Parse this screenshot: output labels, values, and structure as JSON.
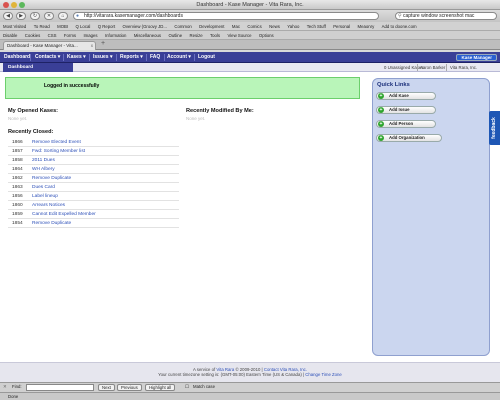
{
  "window": {
    "title": "Dashboard - Kase Manager - Vita Rara, Inc."
  },
  "toolbar": {
    "back": "◀",
    "forward": "▶",
    "reload": "↻",
    "stop": "✕",
    "home": "⌂",
    "url": "http://vitarara.kasemanager.com/dashboards",
    "search_value": "capture window screenshot mac"
  },
  "bookmarks": [
    "Most Visited",
    "To Read",
    "MOBI",
    "Q Local",
    "Q Report",
    "Overview (Groovy JD...",
    "Common",
    "Development",
    "Mac",
    "Comics",
    "News",
    "Yahoo",
    "Tech Stuff",
    "Personal",
    "Meaonry",
    "Add to doone.com"
  ],
  "devbar": [
    "Disable",
    "Cookies",
    "CSS",
    "Forms",
    "Images",
    "Information",
    "Miscellaneous",
    "Outline",
    "Resize",
    "Tools",
    "View Source",
    "Options"
  ],
  "tab": {
    "label": "Dashboard - Kase Manager - Vita...",
    "close": "x",
    "new": "+"
  },
  "appnav": {
    "items": [
      "Dashboard",
      "Contacts ▾",
      "Kases ▾",
      "Issues ▾",
      "Reports ▾",
      "FAQ",
      "Account ▾",
      "Logout"
    ],
    "brand": "Kase Manager"
  },
  "subnav": {
    "active": "Dashboard",
    "right": [
      "0 Unassigned Kases",
      "Aaron Barker",
      "Vita Rara, Inc."
    ]
  },
  "notice": "Logged in successfully",
  "opened": {
    "title": "My Opened Kases:",
    "empty": "None yet."
  },
  "modified": {
    "title": "Recently Modified By Me:",
    "empty": "None yet."
  },
  "closed": {
    "title": "Recently Closed:",
    "rows": [
      {
        "num": "1866",
        "title": "Remove Elected Event"
      },
      {
        "num": "1857",
        "title": "Fwd: Sorting Member list"
      },
      {
        "num": "1858",
        "title": "2011 Dues"
      },
      {
        "num": "1864",
        "title": "WH Albery"
      },
      {
        "num": "1862",
        "title": "Remove Duplicate"
      },
      {
        "num": "1863",
        "title": "Dues Card"
      },
      {
        "num": "1856",
        "title": "Label lineup"
      },
      {
        "num": "1860",
        "title": "Arrears Notices"
      },
      {
        "num": "1859",
        "title": "Cannot Edit Expelled Member"
      },
      {
        "num": "1854",
        "title": "Remove Duplicate"
      }
    ]
  },
  "quick_links": {
    "title": "Quick Links",
    "items": [
      "Add Kase",
      "Add Issue",
      "Add Person",
      "Add Organization"
    ]
  },
  "feedback": "feedback",
  "footer": {
    "line1_prefix": "A service of",
    "line1_company": "Vita Rara",
    "line1_mid": "© 2009-2010 |",
    "line1_contact": "Contact Vita Rara, Inc.",
    "line2_prefix": "Your current timezone setting is: (GMT-05:00) Eastern Time (US & Canada) |",
    "line2_link": "Change Time Zone"
  },
  "findbar": {
    "label": "Find:",
    "next": "Next",
    "previous": "Previous",
    "highlight": "Highlight all",
    "match_case": "Match case"
  },
  "status": "Done"
}
